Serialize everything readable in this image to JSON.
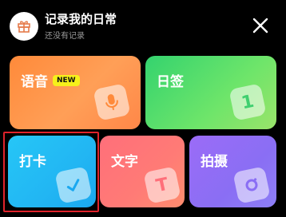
{
  "header": {
    "title": "记录我的日常",
    "subtitle": "还没有记录"
  },
  "cards": {
    "voice": {
      "label": "语音",
      "badge": "NEW"
    },
    "note": {
      "label": "日签",
      "icon_glyph": "1"
    },
    "checkin": {
      "label": "打卡"
    },
    "text": {
      "label": "文字",
      "icon_glyph": "T"
    },
    "photo": {
      "label": "拍摄"
    }
  },
  "colors": {
    "background": "#000000",
    "voice": "#ff8a3a",
    "note": "#34d36e",
    "checkin": "#26c6f6",
    "text": "#ff6f7a",
    "photo": "#9b6cf7",
    "badge": "#f6f01b",
    "highlight": "#e0232b"
  },
  "icons": {
    "avatar": "gift-icon",
    "close": "close-icon",
    "voice": "microphone-icon",
    "note": "number-one-icon",
    "checkin": "checkmark-icon",
    "text": "letter-t-icon",
    "photo": "camera-lens-icon"
  }
}
